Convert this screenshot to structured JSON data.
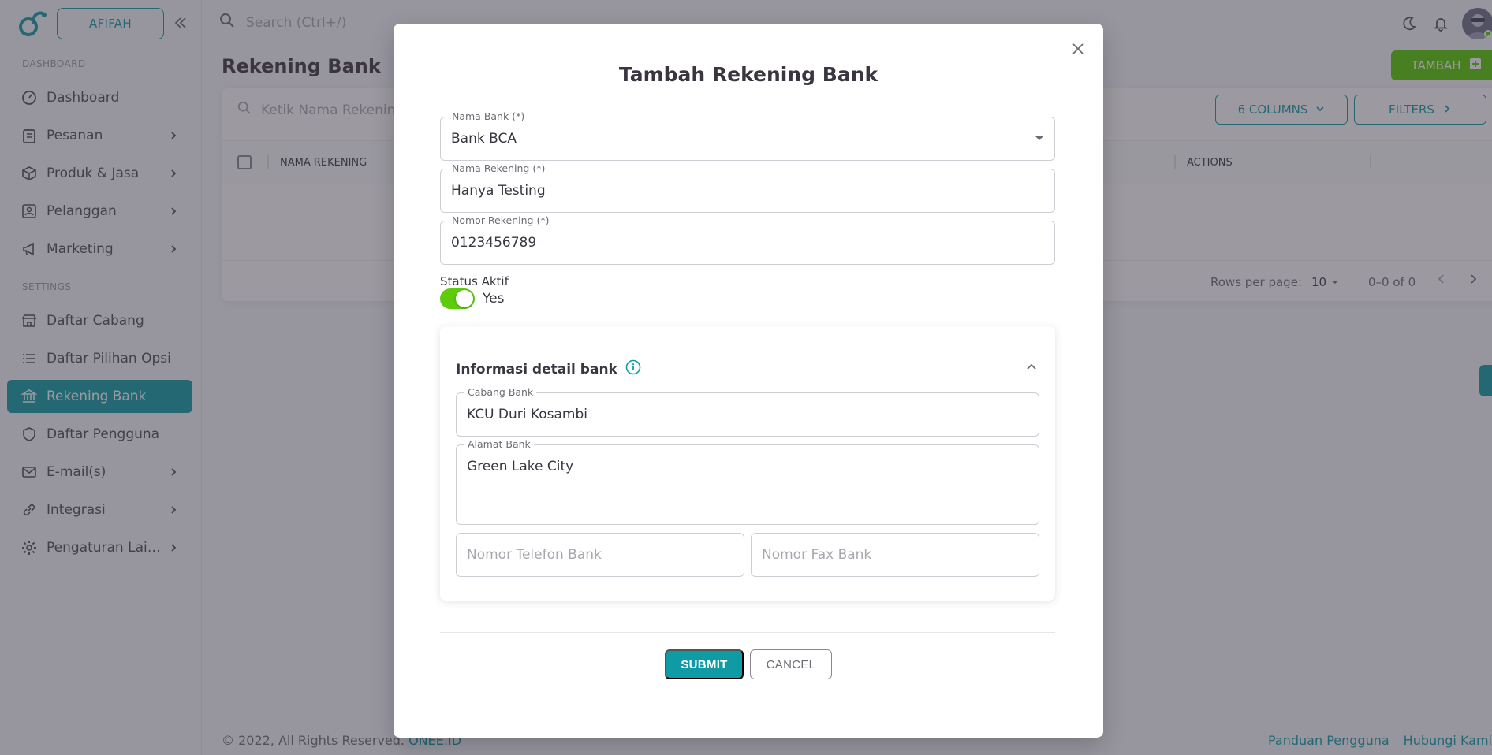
{
  "app": {
    "shop_button": "AFIFAH",
    "search_placeholder": "Search (Ctrl+/)"
  },
  "sidebar": {
    "sections": [
      {
        "label": "DASHBOARD"
      },
      {
        "label": "SETTINGS"
      }
    ],
    "items": [
      {
        "label": "Dashboard",
        "icon": "dashboard-icon",
        "has_chevron": false
      },
      {
        "label": "Pesanan",
        "icon": "clipboard-icon",
        "has_chevron": true
      },
      {
        "label": "Produk & Jasa",
        "icon": "box-icon",
        "has_chevron": true
      },
      {
        "label": "Pelanggan",
        "icon": "contacts-icon",
        "has_chevron": true
      },
      {
        "label": "Marketing",
        "icon": "megaphone-icon",
        "has_chevron": true
      },
      {
        "label": "Daftar Cabang",
        "icon": "store-icon",
        "has_chevron": false
      },
      {
        "label": "Daftar Pilihan Opsi",
        "icon": "list-icon",
        "has_chevron": false
      },
      {
        "label": "Rekening Bank",
        "icon": "bank-icon",
        "has_chevron": false,
        "active": true
      },
      {
        "label": "Daftar Pengguna",
        "icon": "shield-icon",
        "has_chevron": false
      },
      {
        "label": "E-mail(s)",
        "icon": "mail-icon",
        "has_chevron": true
      },
      {
        "label": "Integrasi",
        "icon": "link-icon",
        "has_chevron": true
      },
      {
        "label": "Pengaturan Lain...",
        "icon": "gear-icon",
        "has_chevron": true
      }
    ]
  },
  "page": {
    "title": "Rekening Bank",
    "add_button": "TAMBAH",
    "table_search_placeholder": "Ketik Nama Rekening,",
    "columns_button": "6 COLUMNS",
    "filters_button": "FILTERS",
    "columns": [
      "NAMA REKENING",
      "ACTIONS"
    ],
    "rows_per_page_label": "Rows per page:",
    "rows_per_page_value": "10",
    "range_text": "0–0 of 0"
  },
  "footer": {
    "copyright": "© 2022, All Rights Reserved.",
    "brand_link": "ONEE.ID",
    "links": [
      "Panduan Pengguna",
      "Hubungi Kami"
    ]
  },
  "modal": {
    "title": "Tambah Rekening Bank",
    "fields": {
      "nama_bank": {
        "label": "Nama Bank (*)",
        "value": "Bank BCA"
      },
      "nama_rekening": {
        "label": "Nama Rekening (*)",
        "value": "Hanya Testing"
      },
      "nomor_rekening": {
        "label": "Nomor Rekening (*)",
        "value": "0123456789"
      }
    },
    "status": {
      "label": "Status Aktif",
      "value_text": "Yes",
      "on": true
    },
    "detail": {
      "title": "Informasi detail bank",
      "cabang": {
        "label": "Cabang Bank",
        "value": "KCU Duri Kosambi"
      },
      "alamat": {
        "label": "Alamat Bank",
        "value": "Green Lake City"
      },
      "telefon_placeholder": "Nomor Telefon Bank",
      "fax_placeholder": "Nomor Fax Bank"
    },
    "submit_label": "SUBMIT",
    "cancel_label": "CANCEL"
  },
  "colors": {
    "primary": "#0f9ba5",
    "success": "#56ca00",
    "text": "#3a3541"
  }
}
